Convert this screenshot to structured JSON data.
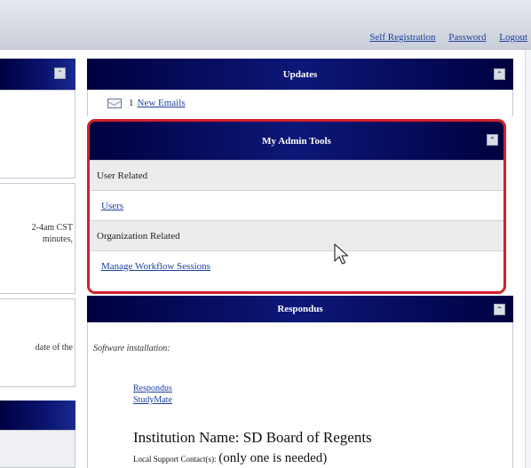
{
  "header": {
    "links": [
      "Self Registration",
      "Password",
      "Logout"
    ]
  },
  "left_panel": {
    "text_1": [
      "2-4am CST",
      "minutes,"
    ],
    "text_2": "date of the"
  },
  "updates": {
    "title": "Updates",
    "count": "1",
    "emails_link": "New Emails"
  },
  "admin_tools": {
    "title": "My Admin Tools",
    "sections": [
      {
        "label": "User Related",
        "links": [
          "Users"
        ]
      },
      {
        "label": "Organization Related",
        "links": [
          "Manage Workflow Sessions"
        ]
      }
    ]
  },
  "respondus": {
    "title": "Respondus",
    "software_label": "Software installation:",
    "links": [
      "Respondus",
      "StudyMate"
    ],
    "institution": "Institution Name: SD Board of Regents",
    "contact_label": "Local Support Contact(s):",
    "contact_note": "(only one is needed)"
  },
  "icons": {
    "collapse": "collapse-icon",
    "mail": "mail-icon",
    "cursor": "mouse-pointer-icon"
  },
  "colors": {
    "header_dark": "#000040",
    "header_mid": "#0c1878",
    "highlight": "#d4202a",
    "link": "#1a3f9e"
  }
}
